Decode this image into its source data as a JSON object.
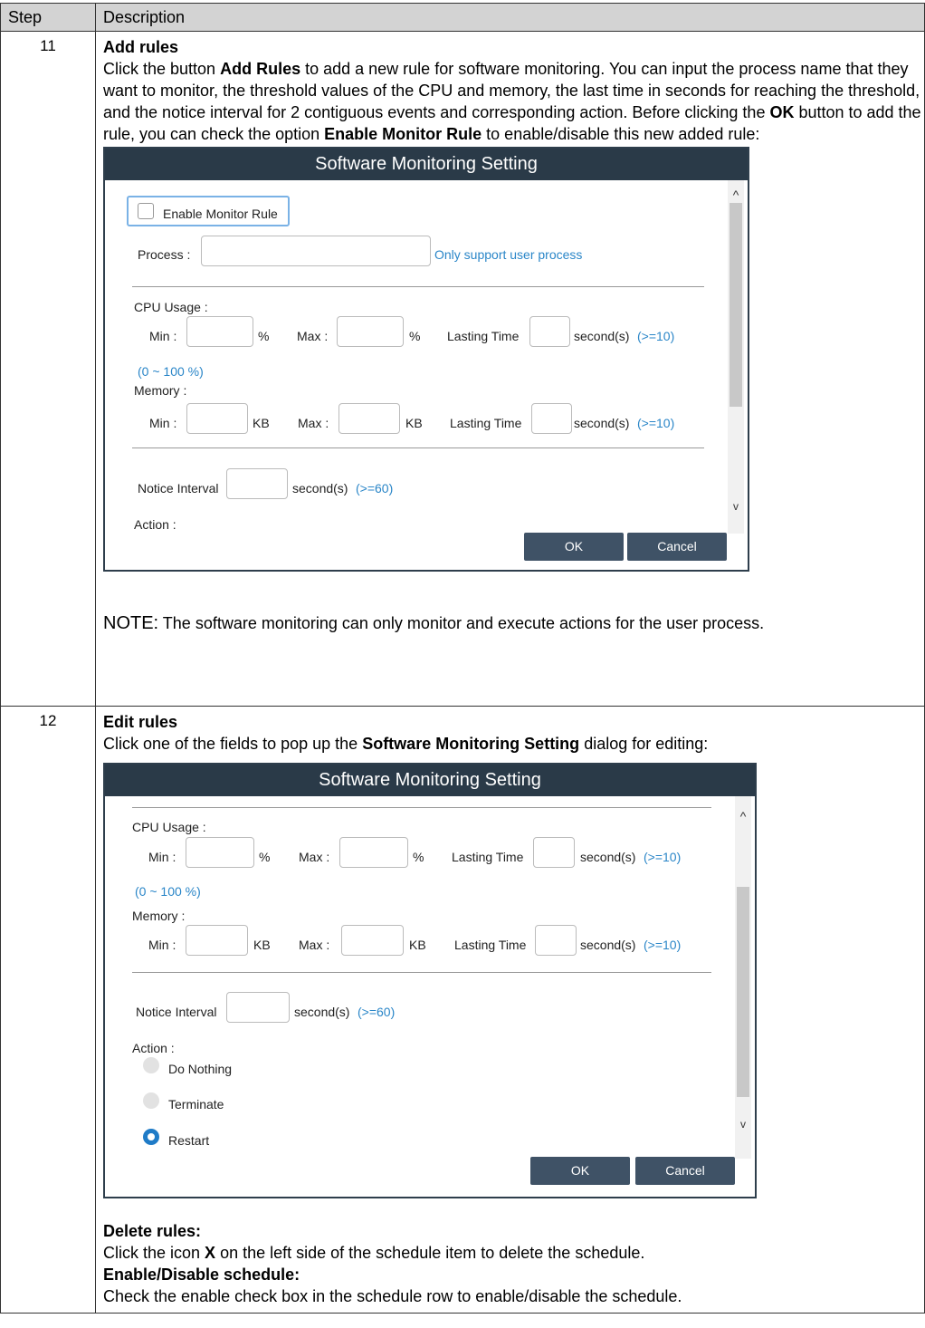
{
  "table": {
    "col_step": "Step",
    "col_description": "Description"
  },
  "step11": {
    "number": "11",
    "heading": "Add rules",
    "p1": "Click the button ",
    "p1_bold": "Add Rules",
    "p2": " to add a new rule for software monitoring. You can input the process name that they want to monitor, the threshold values of the CPU and memory, the last time in seconds for reaching the threshold, and the notice interval for 2 contiguous events and corresponding action. Before clicking the ",
    "p2_bold": "OK",
    "p3": " button to add the rule, you can check the option ",
    "p3_bold": "Enable Monitor Rule",
    "p4": " to enable/disable this new added rule:",
    "note_label": "NOTE:",
    "note_text": " The software monitoring can only monitor and execute actions for the user process."
  },
  "dialog1": {
    "title": "Software Monitoring Setting",
    "enable_monitor_rule": "Enable Monitor Rule",
    "process_label": "Process :",
    "process_hint": "Only support user process",
    "cpu_usage": "CPU Usage :",
    "min": "Min :",
    "max": "Max :",
    "pct": "%",
    "lasting_time": "Lasting Time",
    "seconds": "second(s)",
    "ge10": "(>=10)",
    "range": "(0 ~ 100 %)",
    "memory": "Memory :",
    "kb": "KB",
    "notice_interval": "Notice Interval",
    "ge60": "(>=60)",
    "action": "Action :",
    "ok": "OK",
    "cancel": "Cancel",
    "scroll_up": "^",
    "scroll_down": "v"
  },
  "step12": {
    "number": "12",
    "heading": "Edit rules",
    "p1": "Click one of the fields to pop up the ",
    "p1_bold": "Software Monitoring Setting",
    "p2": " dialog for editing:",
    "delete_heading": "Delete rules:",
    "delete_text_a": "Click the icon ",
    "delete_text_bold": "X",
    "delete_text_b": " on the left side of the schedule item to delete the schedule.",
    "enable_heading": "Enable/Disable schedule:",
    "enable_text": "Check the enable check box in the schedule row to enable/disable the schedule."
  },
  "dialog2": {
    "title": "Software Monitoring Setting",
    "cpu_usage": "CPU Usage :",
    "min": "Min :",
    "max": "Max :",
    "pct": "%",
    "lasting_time": "Lasting Time",
    "seconds": "second(s)",
    "ge10": "(>=10)",
    "range": "(0 ~ 100 %)",
    "memory": "Memory :",
    "kb": "KB",
    "notice_interval": "Notice Interval",
    "ge60": "(>=60)",
    "action": "Action :",
    "opt_do_nothing": "Do Nothing",
    "opt_terminate": "Terminate",
    "opt_restart": "Restart",
    "selected_action": "Restart",
    "ok": "OK",
    "cancel": "Cancel",
    "scroll_up": "^",
    "scroll_down": "v"
  }
}
